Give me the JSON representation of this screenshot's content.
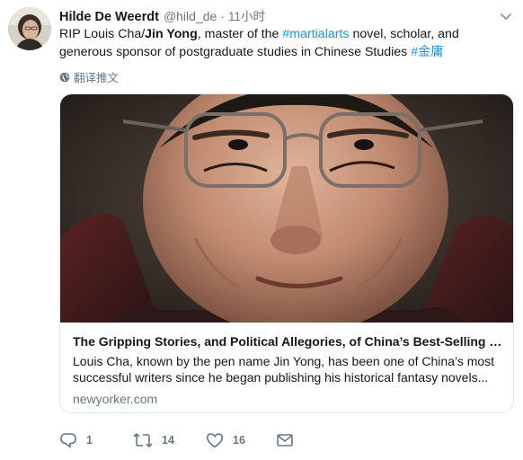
{
  "tweet": {
    "author_name": "Hilde De Weerdt",
    "handle": "@hild_de",
    "separator": "·",
    "time": "11小时",
    "text": {
      "prefix": "RIP Louis Cha/",
      "bold": "Jin Yong",
      "middle1": ", master of the ",
      "hashtag1": "#martialarts",
      "middle2": " novel, scholar, and generous sponsor of postgraduate studies in Chinese Studies ",
      "hashtag2": "#金庸"
    },
    "translate_label": "翻译推文"
  },
  "card": {
    "title": "The Gripping Stories, and Political Allegories, of China’s Best-Selling Novelist",
    "description_line1": "Louis Cha, known by the pen name Jin Yong, has been one of China’s most",
    "description_line2": "successful writers since he began publishing his historical fantasy novels...",
    "domain": "newyorker.com"
  },
  "actions": {
    "reply_count": "1",
    "retweet_count": "14",
    "like_count": "16"
  },
  "icons": {
    "reply": "reply-icon",
    "retweet": "retweet-icon",
    "like": "heart-icon",
    "message": "envelope-icon",
    "menu": "chevron-down-icon",
    "translate": "globe-icon"
  },
  "colors": {
    "link": "#1b95e0",
    "secondary_text": "#657786",
    "primary_text": "#14171a",
    "card_border": "#e1e8ed"
  }
}
